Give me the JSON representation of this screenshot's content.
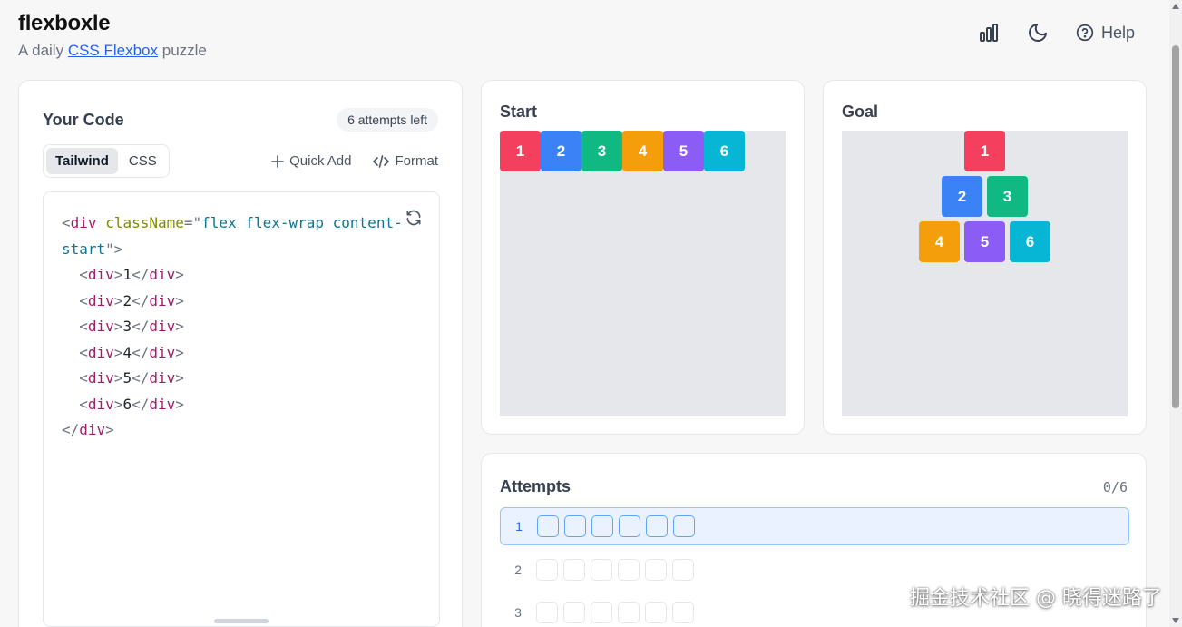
{
  "header": {
    "title": "flexboxle",
    "subtitle_prefix": "A daily ",
    "subtitle_link": "CSS Flexbox",
    "subtitle_suffix": " puzzle",
    "help_label": "Help"
  },
  "code_panel": {
    "title": "Your Code",
    "attempts_badge": "6 attempts left",
    "tabs": [
      {
        "label": "Tailwind",
        "active": true
      },
      {
        "label": "CSS",
        "active": false
      }
    ],
    "quick_add": "Quick Add",
    "format": "Format",
    "code": {
      "tag": "div",
      "attr": "className",
      "value_line1": "flex flex-wrap content-",
      "value_line2": "start",
      "children": [
        "1",
        "2",
        "3",
        "4",
        "5",
        "6"
      ]
    }
  },
  "start": {
    "title": "Start"
  },
  "goal": {
    "title": "Goal"
  },
  "blocks": [
    {
      "label": "1",
      "color": "#f43f5e"
    },
    {
      "label": "2",
      "color": "#3b82f6"
    },
    {
      "label": "3",
      "color": "#10b981"
    },
    {
      "label": "4",
      "color": "#f59e0b"
    },
    {
      "label": "5",
      "color": "#8b5cf6"
    },
    {
      "label": "6",
      "color": "#06b6d4"
    }
  ],
  "attempts": {
    "title": "Attempts",
    "counter": "0/6",
    "rows": [
      {
        "number": "1",
        "current": true
      },
      {
        "number": "2",
        "current": false
      },
      {
        "number": "3",
        "current": false
      }
    ]
  },
  "watermark": "掘金技术社区 @ 晓得迷路了"
}
